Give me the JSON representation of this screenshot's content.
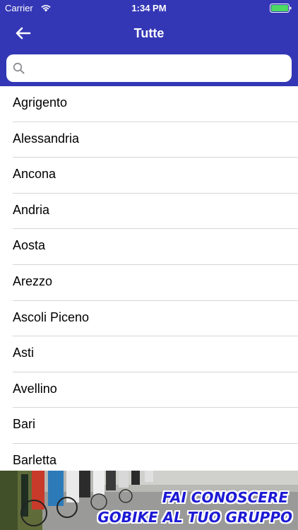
{
  "status": {
    "carrier": "Carrier",
    "time": "1:34 PM"
  },
  "nav": {
    "title": "Tutte",
    "back_icon": "arrow-left-icon"
  },
  "search": {
    "placeholder": "",
    "value": ""
  },
  "cities": [
    {
      "label": "Agrigento"
    },
    {
      "label": "Alessandria"
    },
    {
      "label": "Ancona"
    },
    {
      "label": "Andria"
    },
    {
      "label": "Aosta"
    },
    {
      "label": "Arezzo"
    },
    {
      "label": "Ascoli Piceno"
    },
    {
      "label": "Asti"
    },
    {
      "label": "Avellino"
    },
    {
      "label": "Bari"
    },
    {
      "label": "Barletta"
    }
  ],
  "banner": {
    "line1": "FAI CONOSCERE",
    "line2": "GOBIKE AL TUO GRUPPO"
  },
  "colors": {
    "header": "#3437b5",
    "banner_text": "#1d1ad4"
  }
}
